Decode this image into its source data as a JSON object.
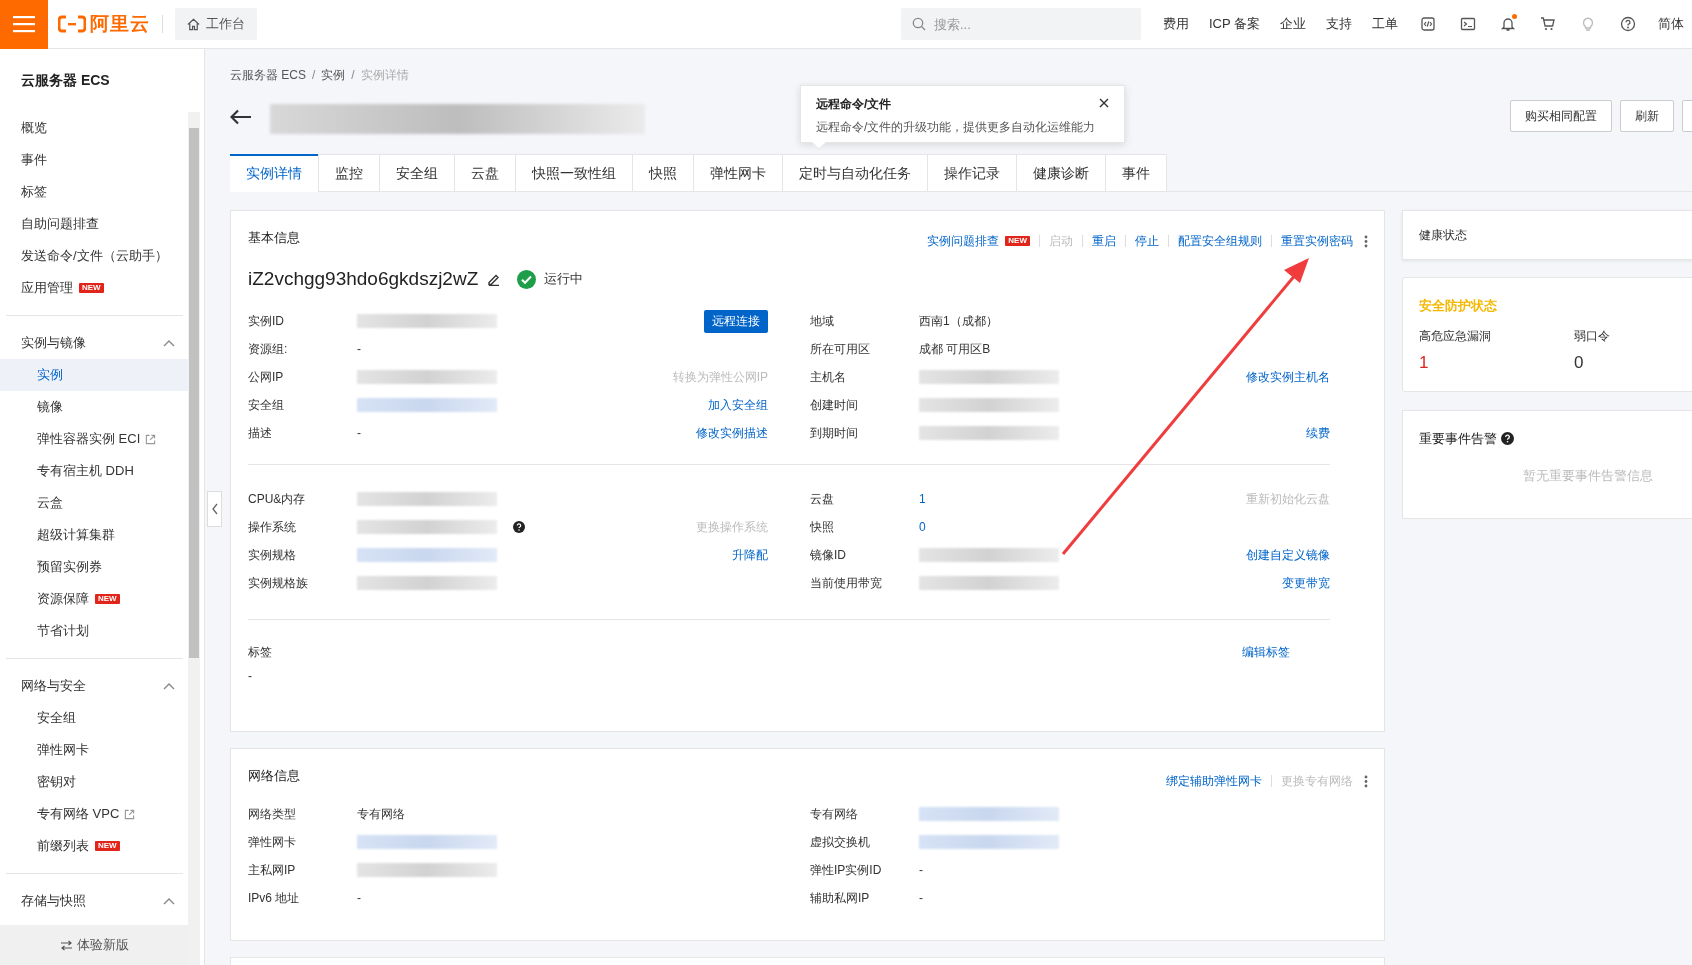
{
  "topbar": {
    "logo": "阿里云",
    "workbench": "工作台",
    "search_placeholder": "搜索...",
    "links": [
      "费用",
      "ICP 备案",
      "企业",
      "支持",
      "工单"
    ],
    "notification_dot": true,
    "language": "简体"
  },
  "sidebar": {
    "title": "云服务器 ECS",
    "items": [
      {
        "label": "概览"
      },
      {
        "label": "事件"
      },
      {
        "label": "标签"
      },
      {
        "label": "自助问题排查"
      },
      {
        "label": "发送命令/文件（云助手）"
      },
      {
        "label": "应用管理",
        "badge": "NEW"
      }
    ],
    "groups": [
      {
        "title": "实例与镜像",
        "expanded": true,
        "items": [
          {
            "label": "实例",
            "selected": true
          },
          {
            "label": "镜像",
            "selected": false
          },
          {
            "label": "弹性容器实例 ECI",
            "selected": false,
            "external": true
          },
          {
            "label": "专有宿主机 DDH",
            "selected": false
          },
          {
            "label": "云盒",
            "selected": false
          },
          {
            "label": "超级计算集群",
            "selected": false
          },
          {
            "label": "预留实例券",
            "selected": false
          },
          {
            "label": "资源保障",
            "selected": false,
            "badge": "NEW"
          },
          {
            "label": "节省计划",
            "selected": false
          }
        ]
      },
      {
        "title": "网络与安全",
        "expanded": true,
        "items": [
          {
            "label": "安全组",
            "selected": false
          },
          {
            "label": "弹性网卡",
            "selected": false
          },
          {
            "label": "密钥对",
            "selected": false
          },
          {
            "label": "专有网络 VPC",
            "selected": false,
            "external": true
          },
          {
            "label": "前缀列表",
            "selected": false,
            "badge": "NEW"
          }
        ]
      },
      {
        "title": "存储与快照",
        "expanded": true
      }
    ],
    "footer": "体验新版"
  },
  "breadcrumb": [
    "云服务器 ECS",
    "实例",
    "实例详情"
  ],
  "breadcrumb_separator": "/",
  "popover": {
    "title": "远程命令/文件",
    "text": "远程命令/文件的升级功能，提供更多自动化运维能力"
  },
  "header_buttons": [
    "购买相同配置",
    "刷新"
  ],
  "tabs": [
    {
      "label": "实例详情",
      "selected": true
    },
    {
      "label": "监控",
      "selected": false
    },
    {
      "label": "安全组",
      "selected": false
    },
    {
      "label": "云盘",
      "selected": false
    },
    {
      "label": "快照一致性组",
      "selected": false
    },
    {
      "label": "快照",
      "selected": false
    },
    {
      "label": "弹性网卡",
      "selected": false
    },
    {
      "label": "定时与自动化任务",
      "selected": false
    },
    {
      "label": "操作记录",
      "selected": false
    },
    {
      "label": "健康诊断",
      "selected": false
    },
    {
      "label": "事件",
      "selected": false
    }
  ],
  "basic_info": {
    "title": "基本信息",
    "actions": [
      {
        "label": "实例问题排查",
        "badge": "NEW",
        "disabled": false
      },
      {
        "label": "启动",
        "disabled": true
      },
      {
        "label": "重启",
        "disabled": false
      },
      {
        "label": "停止",
        "disabled": false
      },
      {
        "label": "配置安全组规则",
        "disabled": false
      },
      {
        "label": "重置实例密码",
        "disabled": false
      }
    ],
    "instance_name": "iZ2vchgg93hdo6gkdszj2wZ",
    "status": "运行中",
    "sections": [
      {
        "left": [
          {
            "label": "实例ID",
            "kind": "redacted",
            "action": {
              "label": "远程连接",
              "kind": "button",
              "disabled": false
            }
          },
          {
            "label": "资源组:",
            "kind": "text",
            "value": "-"
          },
          {
            "label": "公网IP",
            "kind": "redacted",
            "action": {
              "label": "转换为弹性公网IP",
              "kind": "link",
              "disabled": true
            }
          },
          {
            "label": "安全组",
            "kind": "redacted_link",
            "action": {
              "label": "加入安全组",
              "kind": "link",
              "disabled": false
            }
          },
          {
            "label": "描述",
            "kind": "text",
            "value": "-",
            "action": {
              "label": "修改实例描述",
              "kind": "link",
              "disabled": false
            }
          }
        ],
        "right": [
          {
            "label": "地域",
            "kind": "text",
            "value": "西南1（成都）"
          },
          {
            "label": "所在可用区",
            "kind": "text",
            "value": "成都 可用区B"
          },
          {
            "label": "主机名",
            "kind": "redacted",
            "action": {
              "label": "修改实例主机名",
              "kind": "link",
              "disabled": false
            }
          },
          {
            "label": "创建时间",
            "kind": "redacted"
          },
          {
            "label": "到期时间",
            "kind": "redacted",
            "action": {
              "label": "续费",
              "kind": "link",
              "disabled": false
            }
          }
        ]
      },
      {
        "left": [
          {
            "label": "CPU&内存",
            "kind": "redacted"
          },
          {
            "label": "操作系统",
            "kind": "redacted",
            "help": true,
            "action": {
              "label": "更换操作系统",
              "kind": "link",
              "disabled": true
            }
          },
          {
            "label": "实例规格",
            "kind": "redacted_link",
            "action": {
              "label": "升降配",
              "kind": "link",
              "disabled": false
            }
          },
          {
            "label": "实例规格族",
            "kind": "redacted"
          }
        ],
        "right": [
          {
            "label": "云盘",
            "kind": "link",
            "value": "1",
            "action": {
              "label": "重新初始化云盘",
              "kind": "link",
              "disabled": true
            }
          },
          {
            "label": "快照",
            "kind": "link",
            "value": "0"
          },
          {
            "label": "镜像ID",
            "kind": "redacted",
            "action": {
              "label": "创建自定义镜像",
              "kind": "link",
              "disabled": false
            }
          },
          {
            "label": "当前使用带宽",
            "kind": "redacted",
            "action": {
              "label": "变更带宽",
              "kind": "link",
              "disabled": false
            }
          }
        ]
      }
    ],
    "tags": {
      "label": "标签",
      "value": "-",
      "action": "编辑标签"
    }
  },
  "network_info": {
    "title": "网络信息",
    "actions": [
      {
        "label": "绑定辅助弹性网卡",
        "disabled": false
      },
      {
        "label": "更换专有网络",
        "disabled": true
      }
    ],
    "left": [
      {
        "label": "网络类型",
        "kind": "text",
        "value": "专有网络"
      },
      {
        "label": "弹性网卡",
        "kind": "redacted_link"
      },
      {
        "label": "主私网IP",
        "kind": "redacted"
      },
      {
        "label": "IPv6 地址",
        "kind": "text",
        "value": "-"
      }
    ],
    "right": [
      {
        "label": "专有网络",
        "kind": "redacted_link"
      },
      {
        "label": "虚拟交换机",
        "kind": "redacted_link"
      },
      {
        "label": "弹性IP实例ID",
        "kind": "text",
        "value": "-"
      },
      {
        "label": "辅助私网IP",
        "kind": "text",
        "value": "-"
      }
    ]
  },
  "health": {
    "title": "健康状态"
  },
  "security": {
    "title": "安全防护状态",
    "metrics": [
      {
        "label": "高危应急漏洞",
        "value": "1",
        "alert": true
      },
      {
        "label": "弱口令",
        "value": "0",
        "alert": false
      }
    ]
  },
  "events": {
    "title": "重要事件告警",
    "empty_text": "暂无重要事件告警信息"
  }
}
